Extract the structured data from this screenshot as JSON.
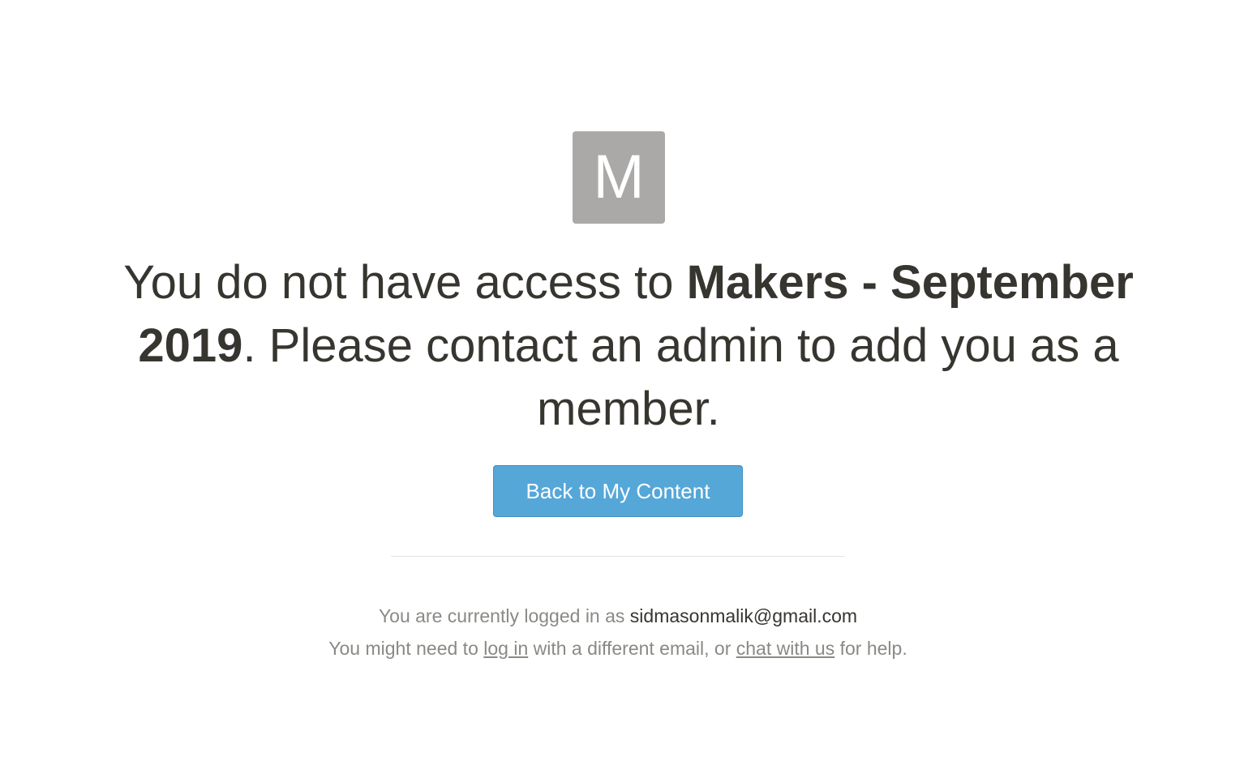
{
  "workspace": {
    "avatar_letter": "M"
  },
  "message": {
    "prefix": "You do not have access to ",
    "workspace_name": "Makers - September 2019",
    "suffix": ". Please contact an admin to add you as a member."
  },
  "actions": {
    "back_label": "Back to My Content"
  },
  "account": {
    "logged_in_prefix": "You are currently logged in as ",
    "email": "sidmasonmalik@gmail.com",
    "help_prefix": "You might need to ",
    "login_link": "log in",
    "help_middle": " with a different email, or ",
    "chat_link": "chat with us",
    "help_suffix": " for help."
  },
  "colors": {
    "button": "#55a7d8",
    "avatar": "#aaa9a7",
    "text": "#37352f",
    "muted_text": "#8a8985"
  }
}
